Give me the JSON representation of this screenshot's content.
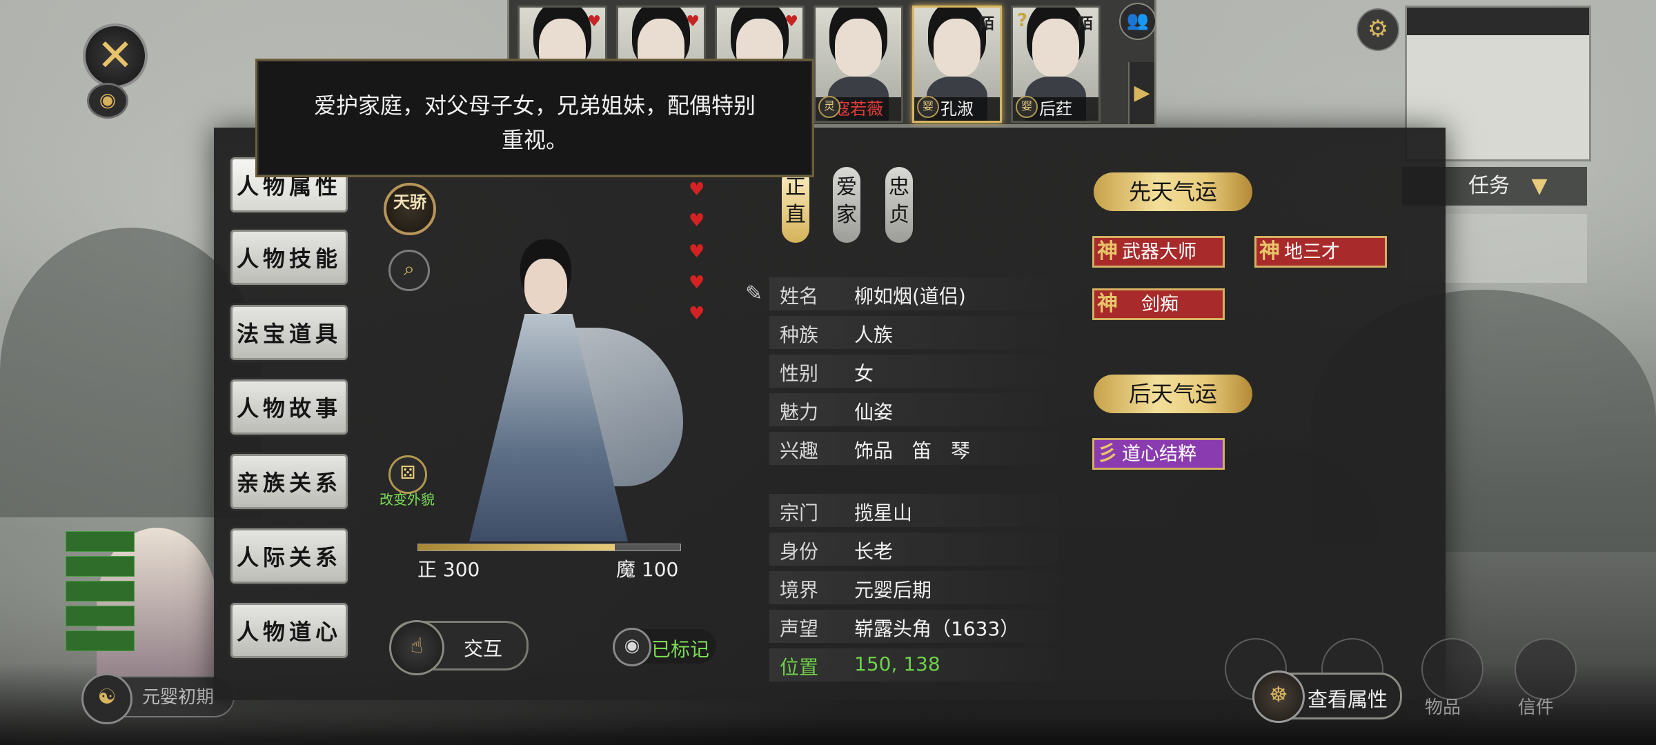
{
  "close": {
    "icon": "close-icon"
  },
  "portrait_strip": {
    "cards": [
      {
        "name": "",
        "tag": "",
        "mark": "♥",
        "selected": false
      },
      {
        "name": "",
        "tag": "",
        "mark": "♥",
        "selected": false
      },
      {
        "name": "",
        "tag": "",
        "mark": "♥",
        "selected": false
      },
      {
        "name": "寇若薇",
        "tag": "灵",
        "mark": "",
        "selected": false,
        "red": true
      },
      {
        "name": "孔淑",
        "tag": "婴",
        "mark": "陌",
        "selected": true
      },
      {
        "name": "后荭",
        "tag": "婴",
        "mark": "陌",
        "selected": false,
        "question": "?"
      }
    ],
    "arrow": "▶",
    "people_icon": "people-icon"
  },
  "tooltip": {
    "text": "爱护家庭，对父母子女，兄弟姐妹，配偶特别重视。"
  },
  "nav": {
    "items": [
      "人物属性",
      "人物技能",
      "法宝道具",
      "人物故事",
      "亲族关系",
      "人际关系",
      "人物道心"
    ],
    "active_index": 0
  },
  "character": {
    "badge": "天骄",
    "change_look": "改变外貌",
    "zheng_label": "正 300",
    "mo_label": "魔 100",
    "bar_fraction": 0.75,
    "hearts": 5,
    "interact_label": "交互",
    "marked_label": "已标记"
  },
  "virtues": [
    "正直",
    "爱家",
    "忠贞"
  ],
  "info": {
    "rows": [
      {
        "k": "姓名",
        "v": "柳如烟(道侣)"
      },
      {
        "k": "种族",
        "v": "人族"
      },
      {
        "k": "性别",
        "v": "女"
      },
      {
        "k": "魅力",
        "v": "仙姿"
      },
      {
        "k": "兴趣",
        "v": "饰品　笛　琴"
      },
      {
        "k": "宗门",
        "v": "揽星山"
      },
      {
        "k": "身份",
        "v": "长老"
      },
      {
        "k": "境界",
        "v": "元婴后期"
      },
      {
        "k": "声望",
        "v": "崭露头角（1633）"
      },
      {
        "k": "位置",
        "v": "150, 138"
      }
    ]
  },
  "fortune": {
    "innate_title": "先天气运",
    "innate": [
      {
        "prefix": "神",
        "name": "武器大师",
        "color": "red"
      },
      {
        "prefix": "神",
        "name": "地三才",
        "color": "red"
      },
      {
        "prefix": "神",
        "name": "剑痴",
        "color": "red"
      }
    ],
    "acquired_title": "后天气运",
    "acquired": [
      {
        "prefix": "彡",
        "name": "道心结粹",
        "color": "purple"
      }
    ]
  },
  "hud": {
    "minimap_header": "",
    "task_label": "任务",
    "task_lines": [
      "",
      ""
    ],
    "realm_pill": "元婴初期",
    "view_attr_label": "查看属性",
    "bottom_labels": [
      "",
      "",
      "物品",
      "信件"
    ]
  },
  "colors": {
    "gold": "#d8b660",
    "green": "#6fd14a",
    "red_trait": "#a82a2a",
    "purple_trait": "#8a3bb0"
  }
}
